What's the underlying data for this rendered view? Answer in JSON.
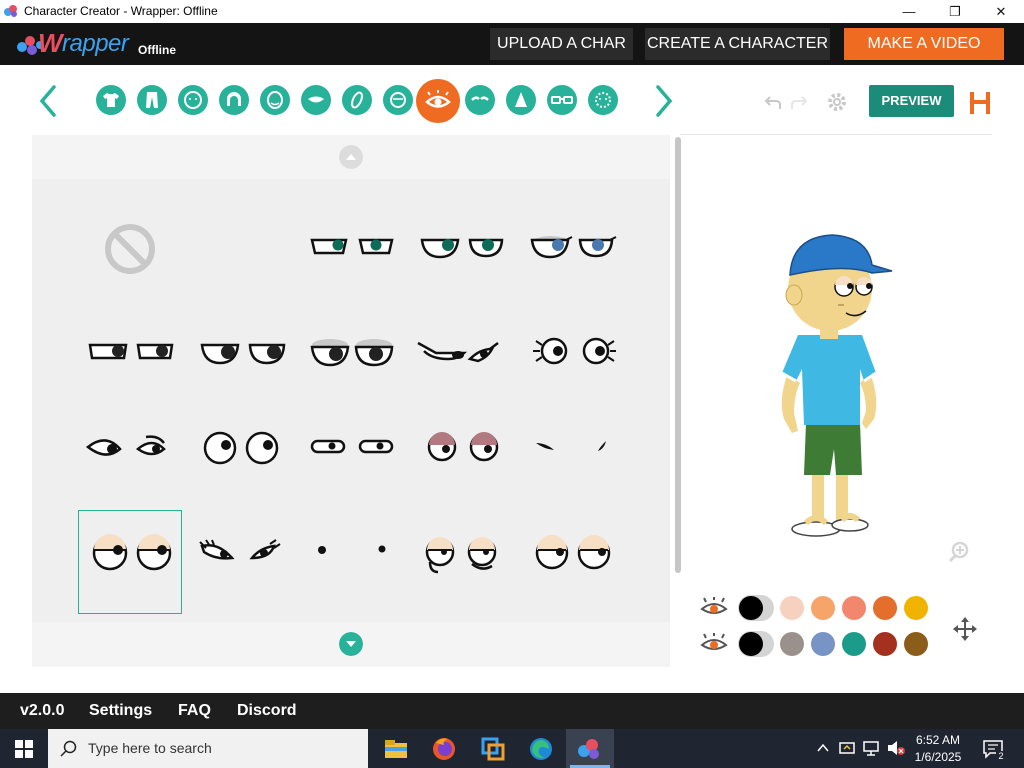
{
  "window": {
    "title": "Character Creator - Wrapper: Offline",
    "minimize": "—",
    "maximize": "❐",
    "close": "✕"
  },
  "brand": {
    "w": "W",
    "rapper": "rapper",
    "offline": "Offline"
  },
  "nav": {
    "upload": "UPLOAD A CHAR",
    "create": "CREATE A CHARACTER",
    "make_video": "MAKE A VIDEO"
  },
  "toolbar": {
    "categories": [
      "shirt",
      "pants",
      "head",
      "hair",
      "face-shape",
      "mouth",
      "accessory",
      "ears",
      "eyes",
      "eyebrows",
      "nose",
      "glasses",
      "beard"
    ],
    "selected_category": "eyes",
    "preview": "PREVIEW"
  },
  "colors": {
    "accent": "#27b299",
    "orange": "#ef6b22",
    "preview_bg": "#1c8c7a",
    "row1": [
      "#000000",
      "#f6d1c0",
      "#f7a46b",
      "#f3876d",
      "#e46f2d",
      "#f0b400"
    ],
    "row2": [
      "#000000",
      "#9b918c",
      "#7893c6",
      "#1b9b8a",
      "#a3311e",
      "#8a5d1a"
    ]
  },
  "footer": {
    "version": "v2.0.0",
    "settings": "Settings",
    "faq": "FAQ",
    "discord": "Discord"
  },
  "taskbar": {
    "search_placeholder": "Type here to search",
    "time": "6:52 AM",
    "date": "1/6/2025",
    "notif_count": "2"
  }
}
